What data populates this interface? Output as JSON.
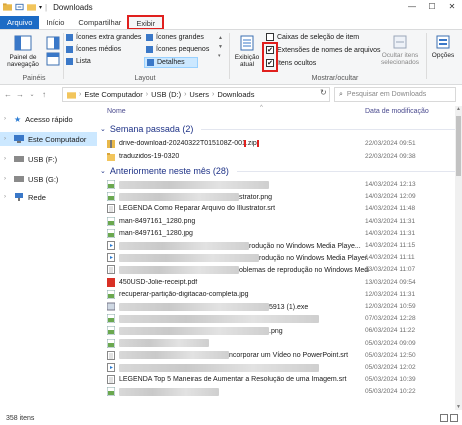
{
  "window": {
    "title": "Downloads",
    "controls": [
      "—",
      "☐",
      "✕"
    ]
  },
  "tabs": [
    {
      "label": "Arquivo"
    },
    {
      "label": "Início"
    },
    {
      "label": "Compartilhar"
    },
    {
      "label": "Exibir"
    }
  ],
  "ribbon": {
    "panes": {
      "nav_label": "Painel de navegação",
      "group": "Painéis"
    },
    "layout": {
      "items": [
        "Ícones extra grandes",
        "Ícones grandes",
        "Ícones médios",
        "Ícones pequenos",
        "Lista",
        "Detalhes"
      ],
      "group": "Layout"
    },
    "current_view": {
      "label": "Exibição atual"
    },
    "show_hide": {
      "item_checkboxes": "Caixas de seleção de item",
      "file_extensions": "Extensões de nomes de arquivos",
      "hidden_items": "Itens ocultos",
      "hide_selected": "Ocultar itens selecionados",
      "group": "Mostrar/ocultar"
    },
    "options": {
      "label": "Opções"
    }
  },
  "address": {
    "path": [
      "Este Computador",
      "USB (D:)",
      "Users",
      "Downloads"
    ],
    "search_placeholder": "Pesquisar em Downloads"
  },
  "nav": {
    "items": [
      {
        "label": "Acesso rápido"
      },
      {
        "label": "Este Computador"
      },
      {
        "label": "USB (F:)"
      },
      {
        "label": "USB (G:)"
      },
      {
        "label": "Rede"
      }
    ]
  },
  "columns": {
    "name": "Nome",
    "date": "Data de modificação"
  },
  "groups": {
    "last_week": "Semana passada (2)",
    "earlier": "Anteriormente neste mês (28)"
  },
  "files_last_week": [
    {
      "name": "drive-download-20240322T015108Z-001",
      "ext": ".zip",
      "date": "22/03/2024 09:51",
      "icon": "zip-folder-icon"
    },
    {
      "name": "traduzidos-19-0320",
      "ext": "",
      "date": "22/03/2024 09:38",
      "icon": "folder-icon"
    }
  ],
  "files_earlier": [
    {
      "name": "",
      "date": "14/03/2024 12:13",
      "icon": "image-icon"
    },
    {
      "name": "strator.png",
      "date": "14/03/2024 12:09",
      "icon": "image-icon"
    },
    {
      "name": "LEGENDA Como Reparar Arquivo do Illustrator.srt",
      "date": "14/03/2024 11:48",
      "icon": "text-file-icon"
    },
    {
      "name": "man-8497161_1280.png",
      "date": "14/03/2024 11:31",
      "icon": "image-icon"
    },
    {
      "name": "man-8497161_1280.jpg",
      "date": "14/03/2024 11:31",
      "icon": "image-icon"
    },
    {
      "name": "rodução no Windows Media Playe...",
      "date": "14/03/2024 11:15",
      "icon": "video-icon"
    },
    {
      "name": "rodução no Windows Media Player.mp4",
      "date": "14/03/2024 11:11",
      "icon": "video-icon"
    },
    {
      "name": "oblemas de reprodução no Windows Media P...",
      "date": "13/03/2024 11:07",
      "icon": "text-file-icon"
    },
    {
      "name": "450USD-Jolie-receipt.pdf",
      "date": "13/03/2024 09:54",
      "icon": "pdf-icon"
    },
    {
      "name": "recuperar-partição-digitacao-completa.jpg",
      "date": "12/03/2024 11:31",
      "icon": "image-icon"
    },
    {
      "name": "5913 (1).exe",
      "date": "12/03/2024 10:59",
      "icon": "exe-icon"
    },
    {
      "name": "",
      "date": "07/03/2024 12:28",
      "icon": "image-icon"
    },
    {
      "name": ".png",
      "date": "06/03/2024 11:22",
      "icon": "image-icon"
    },
    {
      "name": "",
      "date": "05/03/2024 09:09",
      "icon": "image-icon"
    },
    {
      "name": "ncorporar um Vídeo no PowerPoint.srt",
      "date": "05/03/2024 12:50",
      "icon": "text-file-icon"
    },
    {
      "name": "",
      "date": "05/03/2024 12:02",
      "icon": "video-icon"
    },
    {
      "name": "LEGENDA Top 5 Maneiras de Aumentar a Resolução de uma Imagem.srt",
      "date": "05/03/2024 10:39",
      "icon": "text-file-icon"
    },
    {
      "name": "",
      "date": "05/03/2024 10:22",
      "icon": "image-icon"
    }
  ],
  "status": {
    "count": "358 itens"
  },
  "colors": {
    "accent": "#1c6bc5",
    "highlight": "#e0201e",
    "selection": "#cce8ff",
    "group_header": "#1e3287"
  }
}
